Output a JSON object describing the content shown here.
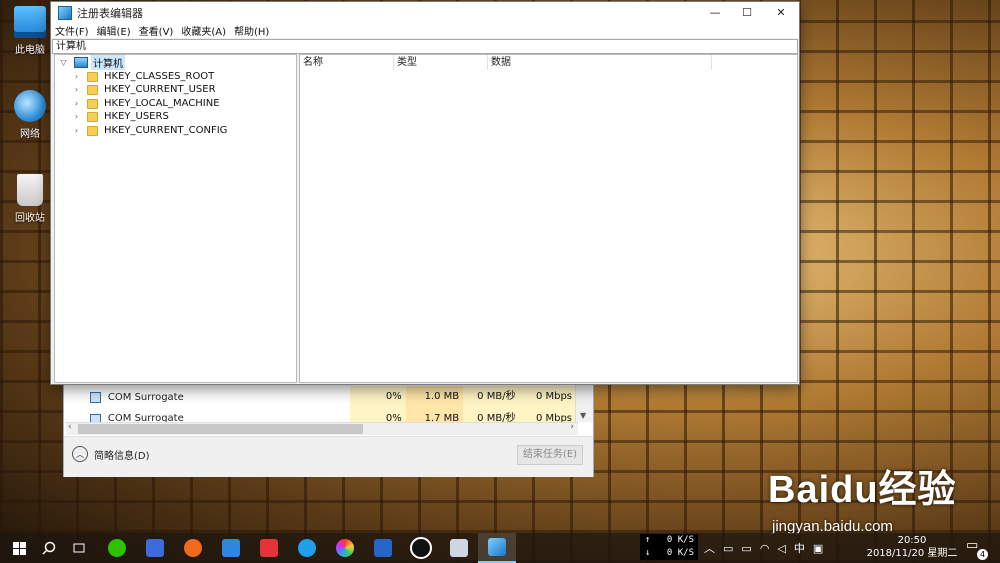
{
  "desktop": {
    "icons": [
      {
        "label": "此电脑",
        "icon": "this-pc-icon"
      },
      {
        "label": "网络",
        "icon": "network-icon"
      },
      {
        "label": "回收站",
        "icon": "recycle-bin-icon"
      }
    ]
  },
  "regedit": {
    "title": "注册表编辑器",
    "window_buttons": {
      "minimize": "—",
      "maximize": "☐",
      "close": "✕"
    },
    "menu": [
      "文件(F)",
      "编辑(E)",
      "查看(V)",
      "收藏夹(A)",
      "帮助(H)"
    ],
    "address": "计算机",
    "tree": {
      "root": "计算机",
      "keys": [
        "HKEY_CLASSES_ROOT",
        "HKEY_CURRENT_USER",
        "HKEY_LOCAL_MACHINE",
        "HKEY_USERS",
        "HKEY_CURRENT_CONFIG"
      ]
    },
    "columns": [
      "名称",
      "类型",
      "数据"
    ]
  },
  "task_manager": {
    "rows": [
      {
        "name": "COM Surrogate",
        "cpu": "0%",
        "memory": "1.0 MB",
        "disk": "0 MB/秒",
        "network": "0 Mbps"
      },
      {
        "name": "COM Surrogate",
        "cpu": "0%",
        "memory": "1.7 MB",
        "disk": "0 MB/秒",
        "network": "0 Mbps"
      }
    ],
    "fewer_details": "简略信息(D)",
    "end_task": "结束任务(E)"
  },
  "taskbar": {
    "net_up": "0 K/S",
    "net_down": "0 K/S",
    "ime": "中",
    "time": "20:50",
    "date": "2018/11/20 星期二",
    "notification_count": "4"
  },
  "watermark": {
    "brand": "Baidu经验",
    "url": "jingyan.baidu.com"
  }
}
